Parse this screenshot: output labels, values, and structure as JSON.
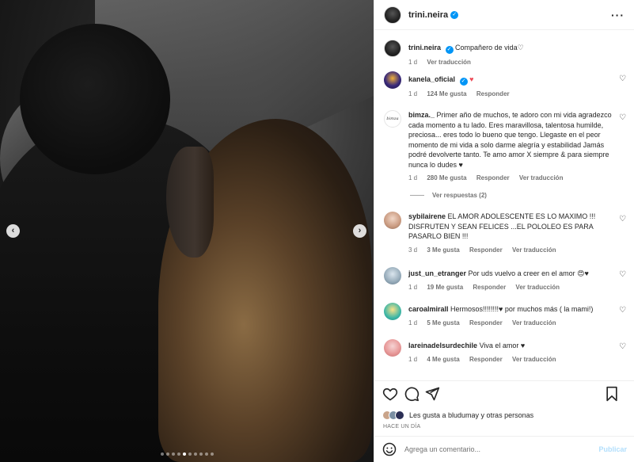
{
  "post": {
    "username": "trini.neira",
    "caption": "Compañero de vida♡",
    "caption_time": "1 d",
    "translate": "Ver traducción"
  },
  "comments": [
    {
      "user": "kanela_oficial",
      "text": "♥",
      "time": "1 d",
      "likes": "124 Me gusta",
      "reply": "Responder"
    },
    {
      "user": "bimza._",
      "text": "Primer año de muchos, te adoro con mi vida agradezco cada momento a tu lado. Eres maravillosa, talentosa humilde, preciosa... eres todo lo bueno que tengo. Llegaste en el peor momento de mi vida a solo darme alegría y estabilidad Jamás podré devolverte tanto. Te amo amor X siempre & para siempre nunca lo dudes ♥",
      "time": "1 d",
      "likes": "280 Me gusta",
      "reply": "Responder",
      "translate": "Ver traducción",
      "replies": "Ver respuestas (2)"
    },
    {
      "user": "sybilairene",
      "text": "EL AMOR ADOLESCENTE ES LO MAXIMO !!! DISFRUTEN Y SEAN FELICES ...EL POLOLEO ES PARA PASARLO BIEN !!!",
      "time": "3 d",
      "likes": "3 Me gusta",
      "reply": "Responder",
      "translate": "Ver traducción"
    },
    {
      "user": "just_un_etranger",
      "text": "Por uds vuelvo a creer en el amor 😍♥",
      "time": "1 d",
      "likes": "19 Me gusta",
      "reply": "Responder",
      "translate": "Ver traducción"
    },
    {
      "user": "caroalmirall",
      "text": "Hermosos!!!!!!!!♥ por muchos más ( la mami!)",
      "time": "1 d",
      "likes": "5 Me gusta",
      "reply": "Responder",
      "translate": "Ver traducción"
    },
    {
      "user": "lareinadelsurdechile",
      "text": "Viva el amor ♥",
      "time": "1 d",
      "likes": "4 Me gusta",
      "reply": "Responder",
      "translate": "Ver traducción"
    }
  ],
  "likes_summary": "Les gusta a bludumay y otras personas",
  "date": "HACE UN DÍA",
  "add_comment": {
    "placeholder": "Agrega un comentario...",
    "publish": "Publicar"
  },
  "icons": [
    "heart-icon",
    "comment-icon",
    "share-icon",
    "save-icon",
    "emoji-icon",
    "more-icon",
    "verified-icon"
  ],
  "colors": {
    "accent": "#0095f6",
    "like_red": "#ed4956",
    "publish_disabled": "#b2dffc"
  }
}
